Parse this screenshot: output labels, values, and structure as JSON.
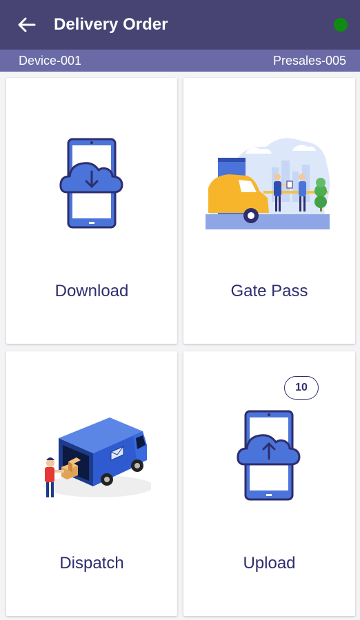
{
  "header": {
    "title": "Delivery Order",
    "back_icon": "arrow-left-icon",
    "status_color": "#0f8a12"
  },
  "subbar": {
    "device": "Device-001",
    "presales": "Presales-005"
  },
  "tiles": [
    {
      "label": "Download",
      "icon": "phone-cloud-download-icon"
    },
    {
      "label": "Gate Pass",
      "icon": "gate-pass-illustration"
    },
    {
      "label": "Dispatch",
      "icon": "delivery-van-illustration"
    },
    {
      "label": "Upload",
      "icon": "phone-cloud-upload-icon",
      "badge": "10"
    }
  ],
  "colors": {
    "appbar": "#474474",
    "subbar": "#6a6aa6",
    "accent_blue": "#4a74d9",
    "text_dark": "#2e2d6e"
  }
}
